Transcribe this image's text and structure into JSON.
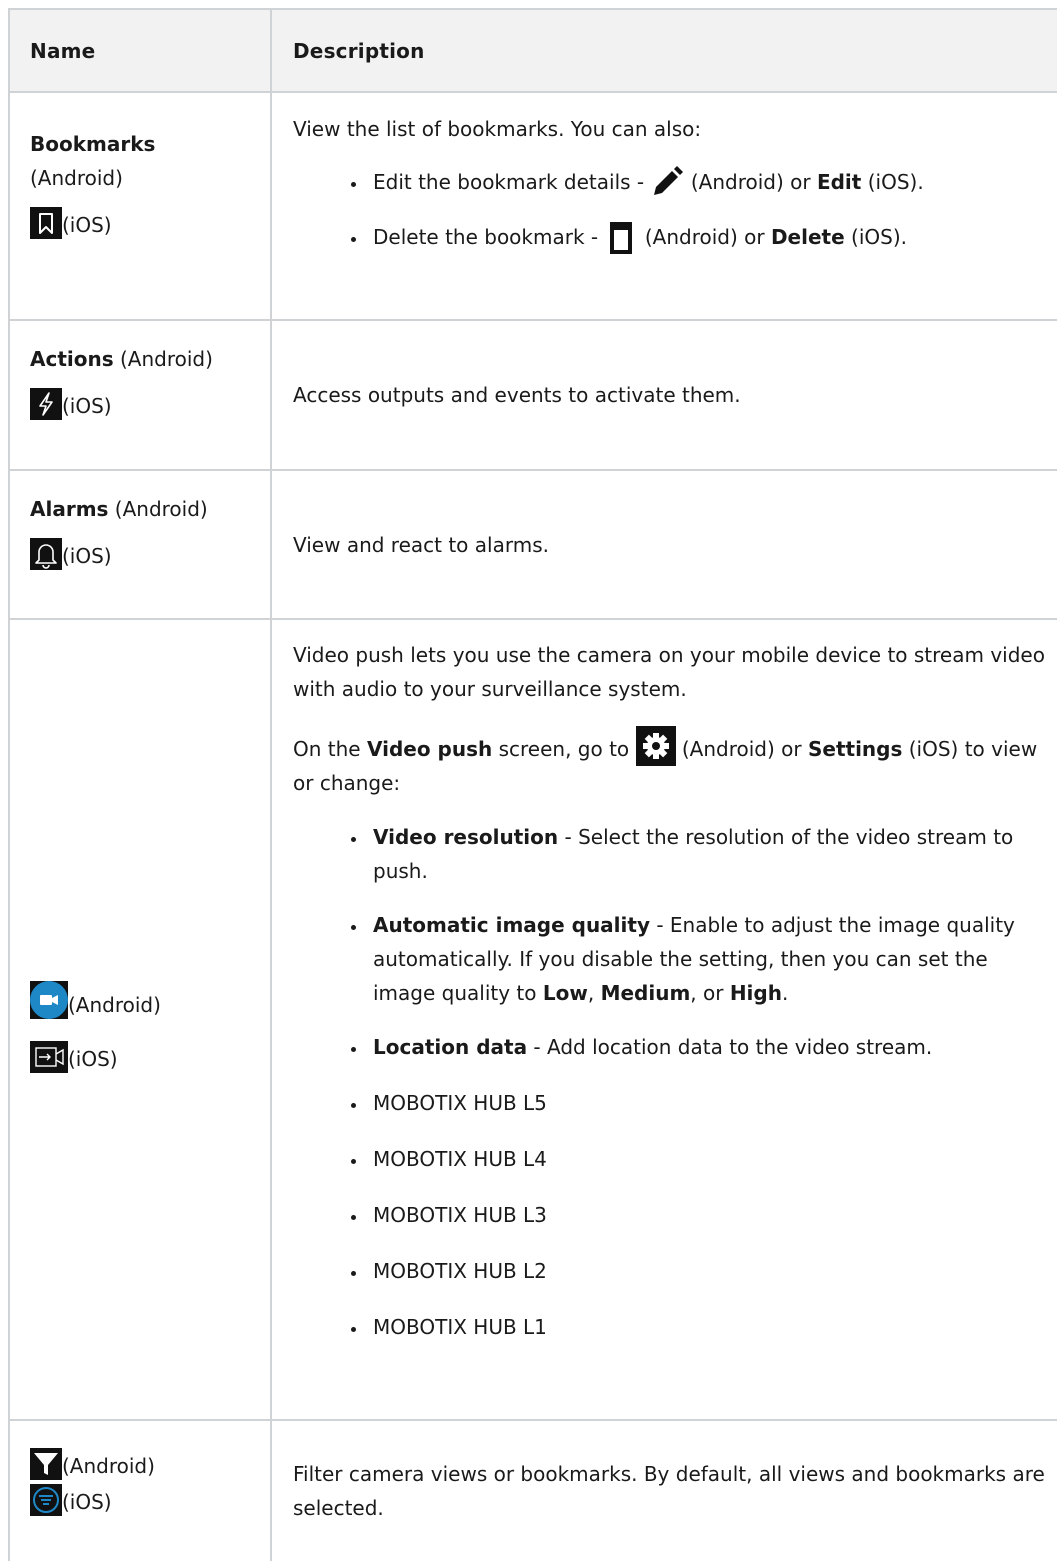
{
  "header": {
    "name": "Name",
    "description": "Description"
  },
  "rows": {
    "bookmarks": {
      "name_bold": "Bookmarks",
      "android": "(Android)",
      "ios": "(iOS)",
      "intro": "View the list of bookmarks. You can also:",
      "b1_pre": "Edit the bookmark details - ",
      "b1_mid": " (Android) or ",
      "b1_bold": "Edit",
      "b1_post": " (iOS).",
      "b2_pre": "Delete the bookmark - ",
      "b2_mid": " (Android) or ",
      "b2_bold": "Delete",
      "b2_post": " (iOS)."
    },
    "actions": {
      "name_bold": "Actions",
      "android": " (Android)",
      "ios": "(iOS)",
      "desc": "Access outputs and events to activate them."
    },
    "alarms": {
      "name_bold": "Alarms",
      "android": " (Android)",
      "ios": "(iOS)",
      "desc": "View and react to alarms."
    },
    "video_push": {
      "android": "(Android)",
      "ios": "(iOS)",
      "p1": "Video push lets you use the camera on your mobile device to stream video with audio to your surveillance system.",
      "p2_pre": "On the ",
      "p2_bold1": "Video push",
      "p2_mid1": " screen, go to ",
      "p2_mid2": " (Android) or ",
      "p2_bold2": "Settings",
      "p2_post": " (iOS) to view or change:",
      "li1_bold": "Video resolution",
      "li1_text": " - Select the resolution of the video stream to push.",
      "li2_bold": "Automatic image quality",
      "li2_text": " - Enable to adjust the image quality automatically. If you disable the setting, then you can set the image quality to ",
      "li2_low": "Low",
      "li2_sep1": ", ",
      "li2_medium": "Medium",
      "li2_sep2": ", or ",
      "li2_high": "High",
      "li2_end": ".",
      "li3_bold": "Location data",
      "li3_text": " - Add location data to the video stream.",
      "products": [
        "MOBOTIX HUB L5",
        "MOBOTIX HUB L4",
        "MOBOTIX HUB L3",
        "MOBOTIX HUB L2",
        "MOBOTIX HUB L1"
      ]
    },
    "filter": {
      "android": "(Android)",
      "ios": "(iOS)",
      "desc": "Filter camera views or bookmarks. By default, all views and bookmarks are selected."
    }
  },
  "colors": {
    "grid": "#cfd3d6",
    "header_bg": "#f2f2f2",
    "android_video_icon": "#1e88c7",
    "ios_filter_ring": "#1e88c7"
  }
}
